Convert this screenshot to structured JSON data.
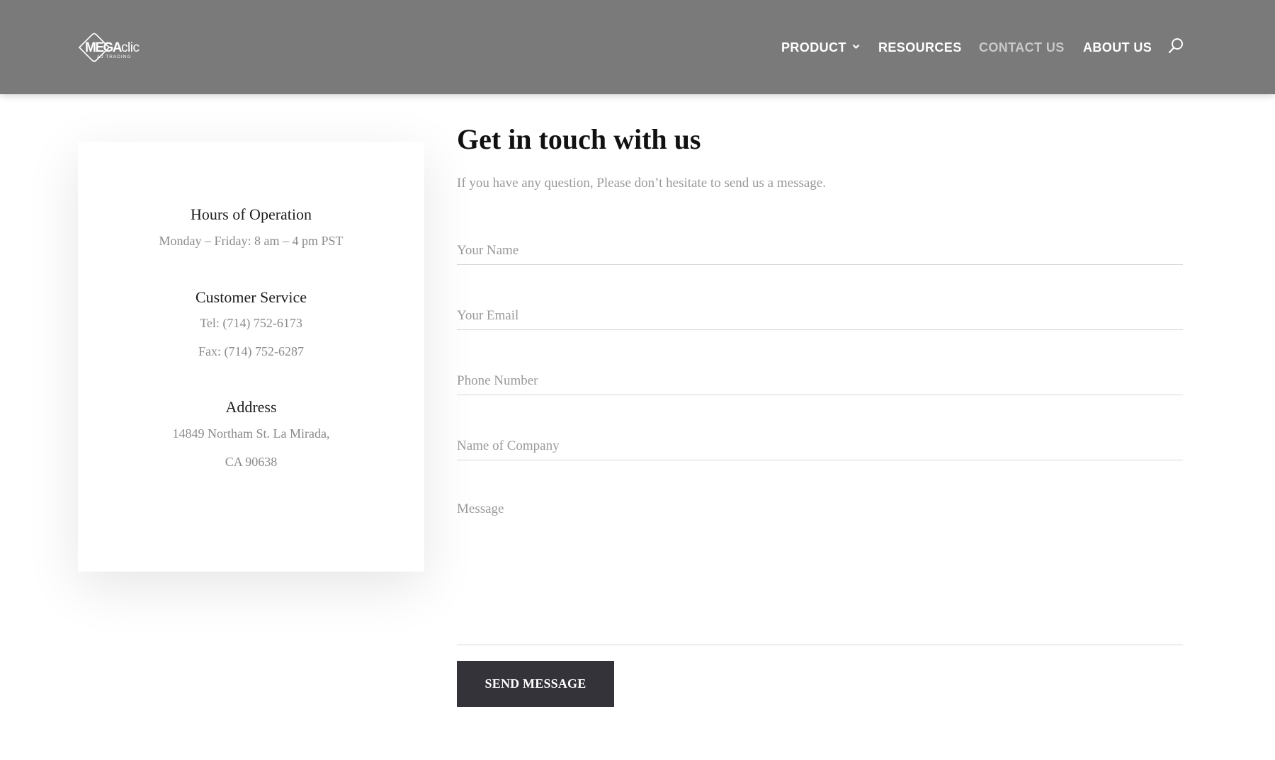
{
  "header": {
    "logo": {
      "mega": "MEGA",
      "clic": "clic",
      "sub": "AJ TRADING"
    },
    "nav": {
      "product": "PRODUCT",
      "resources": "RESOURCES",
      "contact": "CONTACT US",
      "about": "ABOUT US"
    },
    "icons": {
      "product_dropdown": "chevron-down-icon",
      "search": "search-icon"
    },
    "colors": {
      "background": "#7a7a7a",
      "active_link": "#c9c9c9"
    }
  },
  "info_card": {
    "hours": {
      "title": "Hours of Operation",
      "line": "Monday – Friday: 8 am – 4 pm PST"
    },
    "customer_service": {
      "title": "Customer Service",
      "tel": "Tel: (714) 752-6173",
      "fax": "Fax: (714) 752-6287"
    },
    "address": {
      "title": "Address",
      "line1": "14849 Northam St. La Mirada,",
      "line2": "CA 90638"
    }
  },
  "form": {
    "title": "Get in touch with us",
    "subtitle": "If you have any question, Please don’t hesitate to send us a message.",
    "fields": {
      "name_placeholder": "Your Name",
      "email_placeholder": "Your Email",
      "phone_placeholder": "Phone Number",
      "company_placeholder": "Name of Company",
      "message_placeholder": "Message"
    },
    "submit_label": "SEND MESSAGE",
    "colors": {
      "button": "#34333a"
    }
  }
}
